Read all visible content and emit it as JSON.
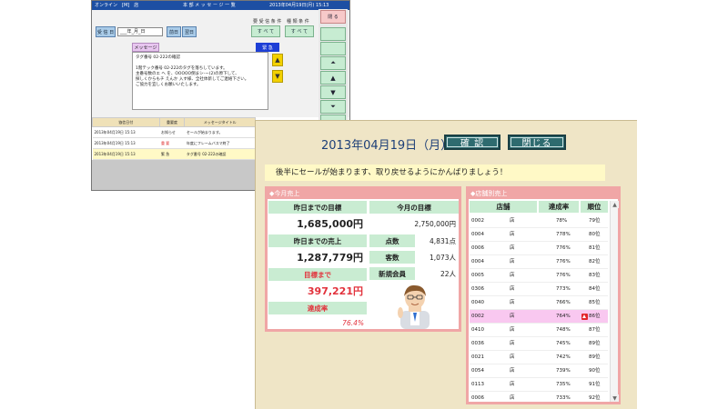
{
  "back_window": {
    "titlebar": {
      "left": "オンライン　[M]　店",
      "center": "本 部 メ ッ セ ー ジ 一 覧",
      "right": "2013年04月19日(月) 15:13"
    },
    "date_label": "受 信 日",
    "date_value": "___年_月_日",
    "prev_day": "前日",
    "next_day": "翌日",
    "condition_label": "要 受 信 条 件",
    "condition_value": "す べ て",
    "category_label": "種 類 条 件",
    "category_value": "す べ て",
    "close_btn": "閉 る",
    "message_tab": "メッセージ",
    "urgent_badge": "緊 急",
    "message_lines": [
      "タグ番号 02-222の確認",
      "",
      "1階テック番号 02-222のタグを落ちしています。",
      "主番号数のエ ヘ を、OOOOO倒まシ-ー(2)の原下して、",
      "探しくからもチ えんか 入す様、全社体新してご連絡下さい。",
      "ご協力を宜しくお願いいたします。"
    ],
    "grid_headers": [
      "協信日付",
      "重要度",
      "メッセージタイトル"
    ],
    "grid_rows": [
      {
        "date": "2013年04月19日 15:13",
        "level": "お知らせ",
        "title": "セールが始まります。",
        "red": false,
        "selected": false
      },
      {
        "date": "2013年04月19日 15:13",
        "level": "重 要",
        "title": "年度にフレームバスマ終了",
        "red": true,
        "selected": false
      },
      {
        "date": "2013年04月19日 15:13",
        "level": "緊 急",
        "title": "タグ番号 02-222の確認",
        "red": false,
        "selected": true
      }
    ]
  },
  "front_window": {
    "date": "2013年04月19日（月）",
    "confirm_btn": "確 認",
    "close_btn": "閉じる",
    "banner": "後半にセールが始まります、取り戻せるようにかんばりましょう！",
    "sales_panel": {
      "title": "◆今月売上",
      "target_to_yesterday_label": "昨日までの目標",
      "target_to_yesterday": "1,685,000円",
      "month_target_label": "今月の目標",
      "month_target": "2,750,000円",
      "sales_to_yesterday_label": "昨日までの売上",
      "sales_to_yesterday": "1,287,779円",
      "items_label": "点数",
      "items_value": "4,831点",
      "customers_label": "客数",
      "customers_value": "1,073人",
      "new_members_label": "新規会員",
      "new_members_value": "22人",
      "to_target_label": "目標まで",
      "to_target": "397,221円",
      "achievement_label": "達成率",
      "achievement": "76.4%"
    },
    "store_panel": {
      "title": "◆店舗別売上",
      "headers": [
        "店舗",
        "達成率",
        "順位"
      ],
      "rows": [
        {
          "code": "0002",
          "store": "店",
          "rate": "78%",
          "rank": "79位",
          "highlight": false
        },
        {
          "code": "0004",
          "store": "店",
          "rate": "778%",
          "rank": "80位",
          "highlight": false
        },
        {
          "code": "0006",
          "store": "店",
          "rate": "776%",
          "rank": "81位",
          "highlight": false
        },
        {
          "code": "0004",
          "store": "店",
          "rate": "776%",
          "rank": "82位",
          "highlight": false
        },
        {
          "code": "0005",
          "store": "店",
          "rate": "776%",
          "rank": "83位",
          "highlight": false
        },
        {
          "code": "0306",
          "store": "店",
          "rate": "773%",
          "rank": "84位",
          "highlight": false
        },
        {
          "code": "0040",
          "store": "店",
          "rate": "766%",
          "rank": "85位",
          "highlight": false
        },
        {
          "code": "0002",
          "store": "店",
          "rate": "764%",
          "rank": "86位",
          "highlight": true
        },
        {
          "code": "0410",
          "store": "店",
          "rate": "748%",
          "rank": "87位",
          "highlight": false
        },
        {
          "code": "0036",
          "store": "店",
          "rate": "745%",
          "rank": "89位",
          "highlight": false
        },
        {
          "code": "0021",
          "store": "店",
          "rate": "742%",
          "rank": "89位",
          "highlight": false
        },
        {
          "code": "0054",
          "store": "店",
          "rate": "739%",
          "rank": "90位",
          "highlight": false
        },
        {
          "code": "0113",
          "store": "店",
          "rate": "735%",
          "rank": "91位",
          "highlight": false
        },
        {
          "code": "0006",
          "store": "店",
          "rate": "733%",
          "rank": "92位",
          "highlight": false
        },
        {
          "code": "0005",
          "store": "店",
          "rate": "73%",
          "rank": "93位",
          "highlight": false
        }
      ]
    }
  },
  "colors": {
    "accent_teal": "#2e6b6f",
    "panel_pink": "#f0a6a6",
    "header_green": "#c9ecd2",
    "highlight_pink": "#f9c8f0",
    "alert_red": "#e2323c"
  }
}
